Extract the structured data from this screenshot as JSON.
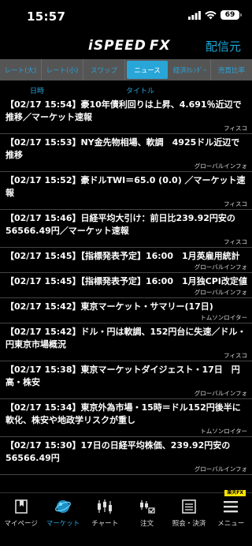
{
  "status": {
    "time": "15:57",
    "battery": "69"
  },
  "header": {
    "logo_i": "i",
    "logo_speed": "SPEED",
    "logo_fx": "FX",
    "right_button": "配信元"
  },
  "tabs": [
    {
      "label": "レート(大)"
    },
    {
      "label": "レート(小)"
    },
    {
      "label": "スワップ"
    },
    {
      "label": "ニュース"
    },
    {
      "label": "経済ｶﾚﾝﾀﾞｰ"
    },
    {
      "label": "売買比率"
    }
  ],
  "columns": {
    "date": "日時",
    "title": "タイトル"
  },
  "news": [
    {
      "title": "【02/17 15:54】豪10年債利回りは上昇、4.691％近辺で推移／マーケット速報",
      "source": "フィスコ"
    },
    {
      "title": "【02/17 15:53】NY金先物相場、軟調　4925ドル近辺で推移",
      "source": "グローバルインフォ"
    },
    {
      "title": "【02/17 15:52】豪ドルTWI＝65.0 (0.0) ／マーケット速報",
      "source": "フィスコ"
    },
    {
      "title": "【02/17 15:46】日経平均大引け：前日比239.92円安の56566.49円／マーケット速報",
      "source": "フィスコ"
    },
    {
      "title": "【02/17 15:45】【指標発表予定】16:00　1月英雇用統計",
      "source": "グローバルインフォ"
    },
    {
      "title": "【02/17 15:45】【指標発表予定】16:00　1月独CPI改定値",
      "source": "グローバルインフォ"
    },
    {
      "title": "【02/17 15:42】東京マーケット・サマリー(17日)",
      "source": "トムソンロイター"
    },
    {
      "title": "【02/17 15:42】ドル・円は軟調、152円台に失速／ドル・円東京市場概況",
      "source": "フィスコ"
    },
    {
      "title": "【02/17 15:38】東京マーケットダイジェスト・17日　円高・株安",
      "source": "グローバルインフォ"
    },
    {
      "title": "【02/17 15:34】東京外為市場・15時＝ドル152円後半に軟化、株安や地政学リスクが重し",
      "source": "トムソンロイター"
    },
    {
      "title": "【02/17 15:30】17日の日経平均株価、239.92円安の56566.49円",
      "source": "グローバルインフォ"
    }
  ],
  "bottom_nav": [
    {
      "label": "マイページ",
      "icon": "bookmark-icon"
    },
    {
      "label": "マーケット",
      "icon": "globe-icon"
    },
    {
      "label": "チャート",
      "icon": "candlestick-icon"
    },
    {
      "label": "注文",
      "icon": "order-icon"
    },
    {
      "label": "照会・決済",
      "icon": "document-icon"
    },
    {
      "label": "メニュー",
      "icon": "menu-icon",
      "badge": "楽天FX"
    }
  ],
  "colors": {
    "accent": "#29a6d8",
    "tab_bar": "#555555",
    "background": "#000000"
  }
}
